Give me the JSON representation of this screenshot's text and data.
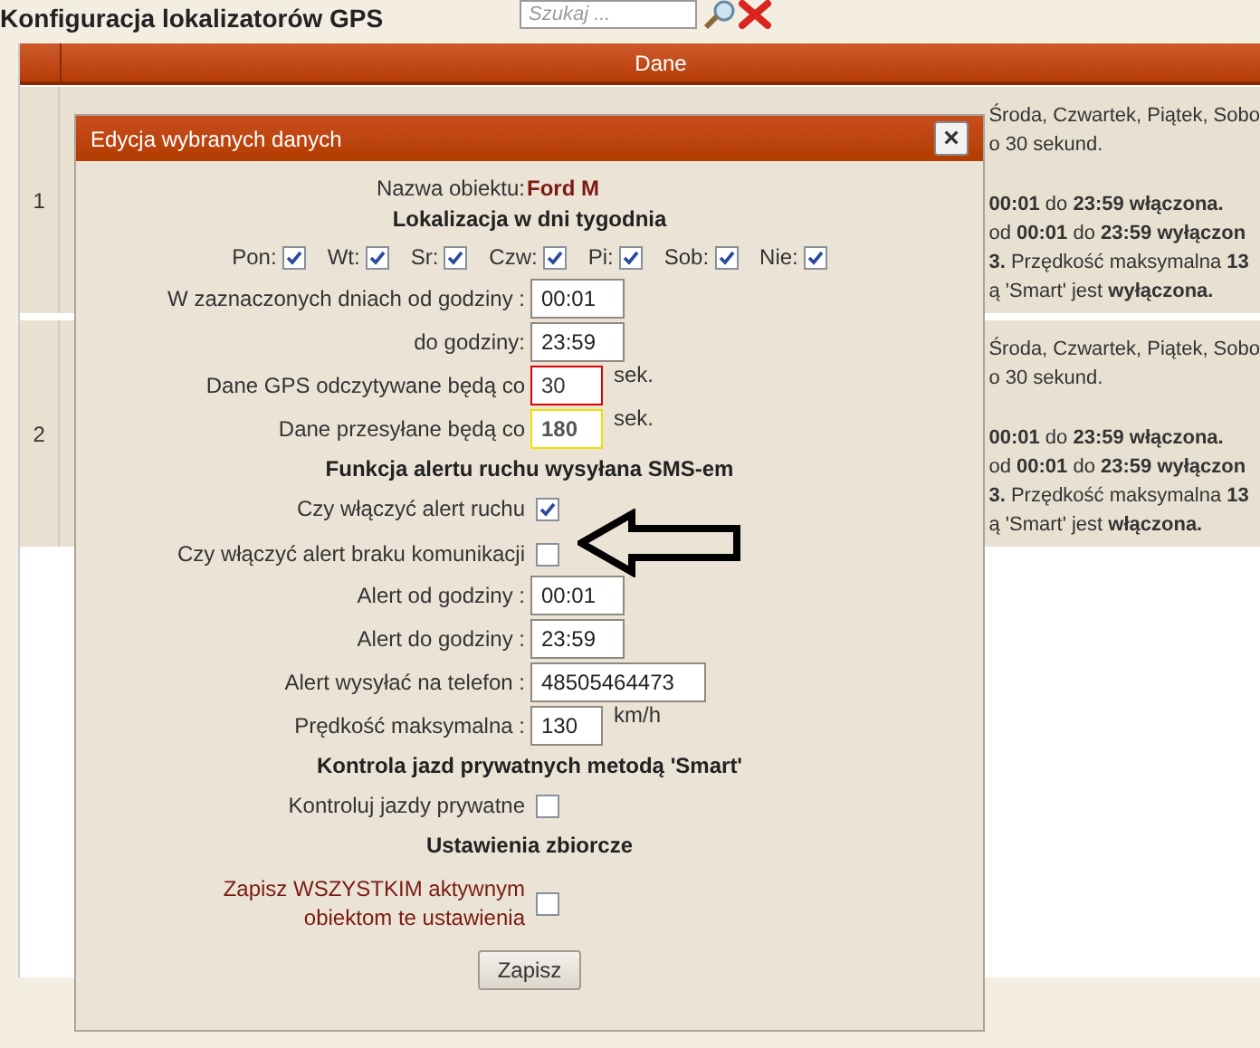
{
  "header": {
    "title": "Konfiguracja lokalizatorów GPS",
    "search": {
      "placeholder": "Szukaj ..."
    }
  },
  "table": {
    "columns": [
      "Dane"
    ],
    "rows": [
      {
        "number": "1",
        "lines": [
          "Środa, Czwartek, Piątek, Sobo",
          "o 30 sekund.",
          "**00:01** do **23:59 włączona.**",
          "od **00:01** do **23:59 wyłączon**",
          "**3.** Przędkość maksymalna **13**",
          "ą 'Smart' jest **wyłączona.**"
        ]
      },
      {
        "number": "2",
        "lines": [
          "Środa, Czwartek, Piątek, Sobo",
          "o 30 sekund.",
          "**00:01** do **23:59 włączona.**",
          "od **00:01** do **23:59 wyłączon**",
          "**3.** Przędkość maksymalna **13**",
          "ą 'Smart' jest **włączona.**"
        ]
      }
    ]
  },
  "dialog": {
    "title": "Edycja wybranych danych",
    "close": "×",
    "fields": [
      {
        "kind": "name",
        "label": "Nazwa obiektu:",
        "value": "Ford M"
      },
      {
        "kind": "heading",
        "label": "Lokalizacja w dni tygodnia"
      },
      {
        "kind": "days",
        "items": [
          {
            "label": "Pon:",
            "checked": true
          },
          {
            "label": "Wt:",
            "checked": true
          },
          {
            "label": "Sr:",
            "checked": true
          },
          {
            "label": "Czw:",
            "checked": true
          },
          {
            "label": "Pi:",
            "checked": true
          },
          {
            "label": "Sob:",
            "checked": true
          },
          {
            "label": "Nie:",
            "checked": true
          }
        ]
      },
      {
        "kind": "input",
        "label": "W zaznaczonych dniach od godziny :",
        "value": "00:01"
      },
      {
        "kind": "input",
        "label": "do godziny:",
        "value": "23:59"
      },
      {
        "kind": "input",
        "label": "Dane GPS odczytywane będą co",
        "value": "30",
        "unit": "sek.",
        "invalid": true
      },
      {
        "kind": "input",
        "label": "Dane przesyłane będą co",
        "value": "180",
        "unit": "sek.",
        "highlighted": true
      },
      {
        "kind": "heading",
        "label": "Funkcja alertu ruchu wysyłana SMS-em"
      },
      {
        "kind": "checkbox",
        "label": "Czy włączyć alert ruchu",
        "checked": true
      },
      {
        "kind": "checkbox",
        "label": "Czy włączyć alert braku komunikacji",
        "checked": false,
        "annotated": true
      },
      {
        "kind": "input",
        "label": "Alert od godziny :",
        "value": "00:01"
      },
      {
        "kind": "input",
        "label": "Alert do godziny :",
        "value": "23:59"
      },
      {
        "kind": "input",
        "label": "Alert wysyłać na telefon :",
        "value": "48505464473"
      },
      {
        "kind": "input",
        "label": "Prędkość maksymalna :",
        "value": "130",
        "unit": "km/h"
      },
      {
        "kind": "heading",
        "label": "Kontrola jazd prywatnych metodą 'Smart'"
      },
      {
        "kind": "checkbox",
        "label": "Kontroluj jazdy prywatne",
        "checked": false
      },
      {
        "kind": "heading",
        "label": "Ustawienia zbiorcze"
      },
      {
        "kind": "checkbox",
        "label": "Zapisz WSZYSTKIM aktywnym obiektom te ustawienia",
        "checked": false,
        "warn": true
      }
    ],
    "button": "Zapisz"
  }
}
